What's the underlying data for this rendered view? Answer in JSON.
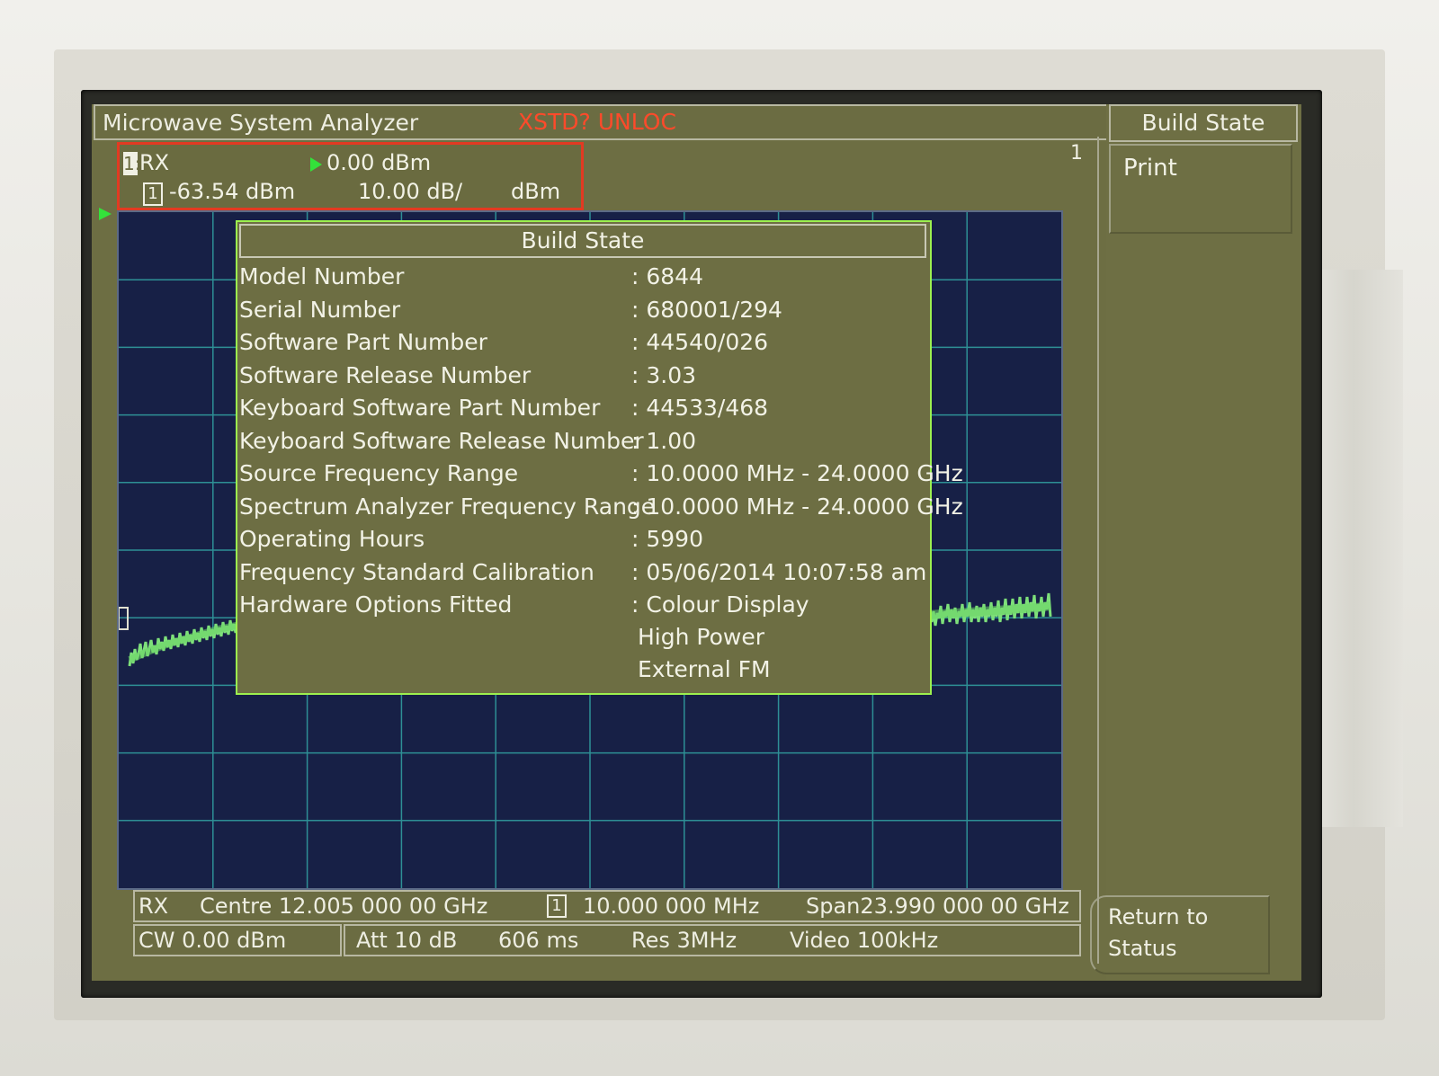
{
  "header": {
    "app_title": "Microwave System Analyzer",
    "status_alert": "XSTD? UNLOC",
    "trace_number": "1"
  },
  "marker": {
    "id": "1:",
    "label": "RX",
    "ref_level": "0.00 dBm",
    "marker_number": "1",
    "marker_value": "-63.54 dBm",
    "scale": "10.00 dB/",
    "unit": "dBm"
  },
  "softkeys": {
    "title": "Build State",
    "print": "Print",
    "return_line1": "Return to",
    "return_line2": "Status"
  },
  "build_state": {
    "title": "Build State",
    "rows": [
      {
        "label": "Model Number",
        "value": ": 6844"
      },
      {
        "label": "Serial Number",
        "value": ": 680001/294"
      },
      {
        "label": "Software Part Number",
        "value": ": 44540/026"
      },
      {
        "label": "Software Release Number",
        "value": ": 3.03"
      },
      {
        "label": "Keyboard Software Part Number",
        "value": ": 44533/468"
      },
      {
        "label": "Keyboard Software Release Number",
        "value": ": 1.00"
      },
      {
        "label": "Source Frequency Range",
        "value": ": 10.0000 MHz - 24.0000 GHz"
      },
      {
        "label": "Spectrum Analyzer Frequency Range",
        "value": ": 10.0000 MHz - 24.0000 GHz"
      },
      {
        "label": "Operating Hours",
        "value": ": 5990"
      },
      {
        "label": "Frequency Standard Calibration",
        "value": ": 05/06/2014 10:07:58 am"
      },
      {
        "label": "Hardware Options Fitted",
        "value": ": Colour Display"
      }
    ],
    "extra_options": [
      "High Power",
      "External FM"
    ]
  },
  "status_bar_1": {
    "mode": "RX",
    "centre": "Centre 12.005 000 00 GHz",
    "marker_number": "1",
    "marker_freq": "10.000 000 MHz",
    "span": "Span23.990 000 00 GHz"
  },
  "status_bar_2": {
    "cw": "CW 0.00 dBm",
    "att": "Att 10 dB",
    "sweep": "606 ms",
    "res": "Res 3MHz",
    "video": "Video 100kHz"
  },
  "colors": {
    "display_bg": "#6d6e43",
    "graticule_bg": "#172046",
    "grid": "#2e8f95",
    "trace": "#7ee07a",
    "alert": "#ff4a2a",
    "panel_border": "#9cf04e"
  }
}
